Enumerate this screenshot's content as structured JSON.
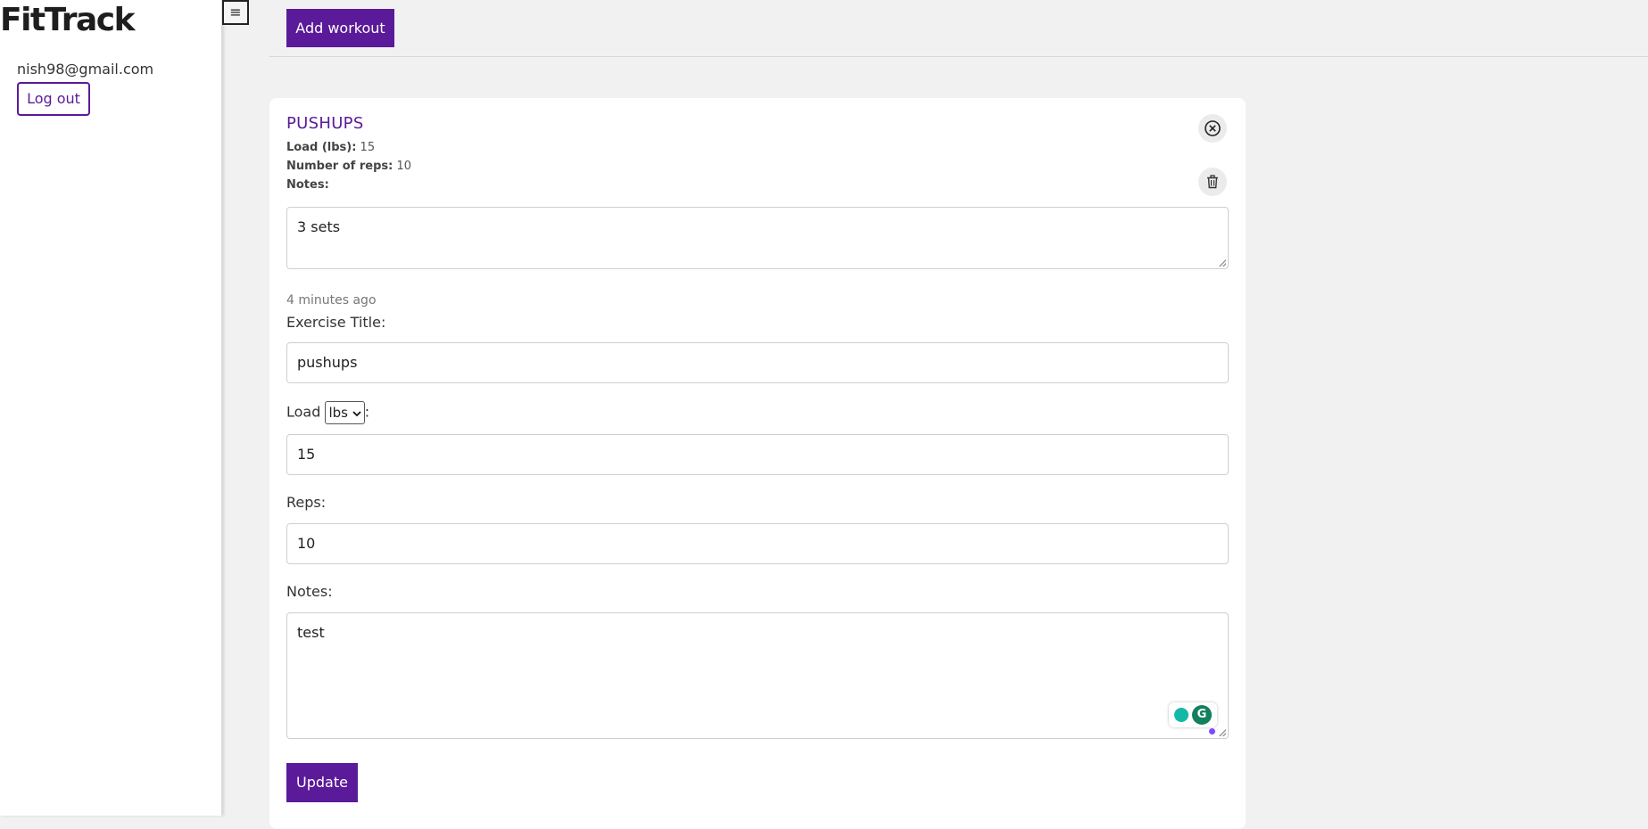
{
  "app": {
    "logo": "FitTrack",
    "user_email": "nish98@gmail.com",
    "logout_label": "Log out",
    "menu_icon": "hamburger-icon",
    "menu_glyph": "≡"
  },
  "toolbar": {
    "add_label": "Add workout"
  },
  "workout": {
    "title": "PUSHUPS",
    "load_label": "Load (lbs):",
    "load_value": "15",
    "reps_label": "Number of reps:",
    "reps_value": "10",
    "notes_label": "Notes:",
    "notes_value": "3 sets",
    "time_ago": "4 minutes ago",
    "close_icon": "close-circle-icon",
    "delete_icon": "trash-icon"
  },
  "form": {
    "title_label": "Exercise Title:",
    "title_value": "pushups",
    "load_label": "Load",
    "load_unit": "lbs",
    "load_suffix": ":",
    "load_value": "15",
    "reps_label": "Reps:",
    "reps_value": "10",
    "notes_label": "Notes:",
    "notes_value": "test",
    "update_label": "Update",
    "grammarly_logo": "G"
  },
  "colors": {
    "accent": "#5b1a99",
    "background": "#f1f1f1"
  }
}
